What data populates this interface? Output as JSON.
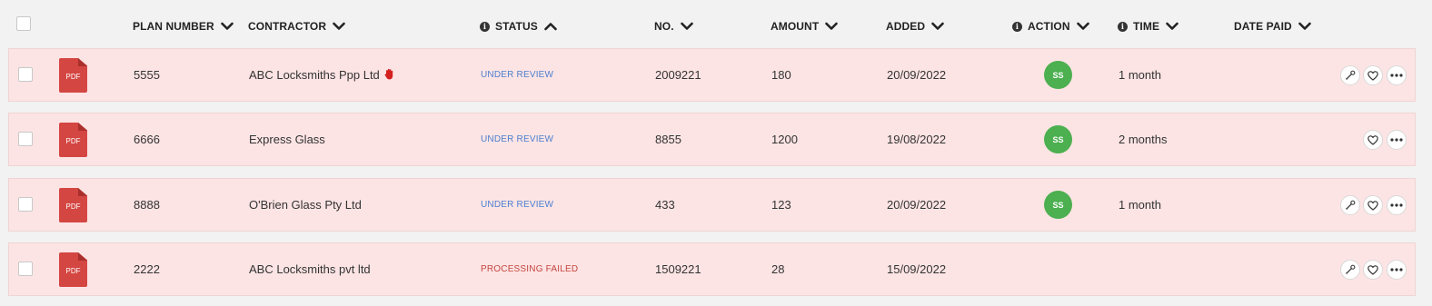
{
  "header": {
    "columns": [
      {
        "label": "PLAN NUMBER",
        "sort": "down",
        "info": false
      },
      {
        "label": "CONTRACTOR",
        "sort": "down",
        "info": false
      },
      {
        "label": "STATUS",
        "sort": "up",
        "info": true
      },
      {
        "label": "NO.",
        "sort": "down",
        "info": false
      },
      {
        "label": "AMOUNT",
        "sort": "down",
        "info": false
      },
      {
        "label": "ADDED",
        "sort": "down",
        "info": false
      },
      {
        "label": "ACTION",
        "sort": "down",
        "info": true
      },
      {
        "label": "TIME",
        "sort": "down",
        "info": true
      },
      {
        "label": "DATE PAID",
        "sort": "down",
        "info": false
      }
    ],
    "info_glyph": "i"
  },
  "rows": [
    {
      "file_label": "PDF",
      "plan_number": "5555",
      "contractor": "ABC Locksmiths Ppp Ltd",
      "flag_icon": "hand-stop-icon",
      "status": "UNDER REVIEW",
      "status_type": "review",
      "no": "2009221",
      "amount": "180",
      "added": "20/09/2022",
      "action_initials": "SS",
      "time": "1 month",
      "date_paid": "",
      "actions": [
        "wrench-icon",
        "heart-icon",
        "more-icon"
      ]
    },
    {
      "file_label": "PDF",
      "plan_number": "6666",
      "contractor": "Express Glass",
      "flag_icon": "",
      "status": "UNDER REVIEW",
      "status_type": "review",
      "no": "8855",
      "amount": "1200",
      "added": "19/08/2022",
      "action_initials": "SS",
      "time": "2 months",
      "date_paid": "",
      "actions": [
        "heart-icon",
        "more-icon"
      ]
    },
    {
      "file_label": "PDF",
      "plan_number": "8888",
      "contractor": "O'Brien Glass Pty Ltd",
      "flag_icon": "",
      "status": "UNDER REVIEW",
      "status_type": "review",
      "no": "433",
      "amount": "123",
      "added": "20/09/2022",
      "action_initials": "SS",
      "time": "1 month",
      "date_paid": "",
      "actions": [
        "wrench-icon",
        "heart-icon",
        "more-icon"
      ]
    },
    {
      "file_label": "PDF",
      "plan_number": "2222",
      "contractor": "ABC Locksmiths pvt ltd",
      "flag_icon": "",
      "status": "PROCESSING FAILED",
      "status_type": "failed",
      "no": "1509221",
      "amount": "28",
      "added": "15/09/2022",
      "action_initials": "",
      "time": "",
      "date_paid": "",
      "actions": [
        "wrench-icon",
        "heart-icon",
        "more-icon"
      ]
    }
  ],
  "colors": {
    "row_background": "#fde4e4",
    "status_review": "#4a7fd0",
    "status_failed": "#c4463f",
    "avatar_green": "#4caf50",
    "pdf_red": "#d44642",
    "flag_red": "#d41f1f"
  }
}
